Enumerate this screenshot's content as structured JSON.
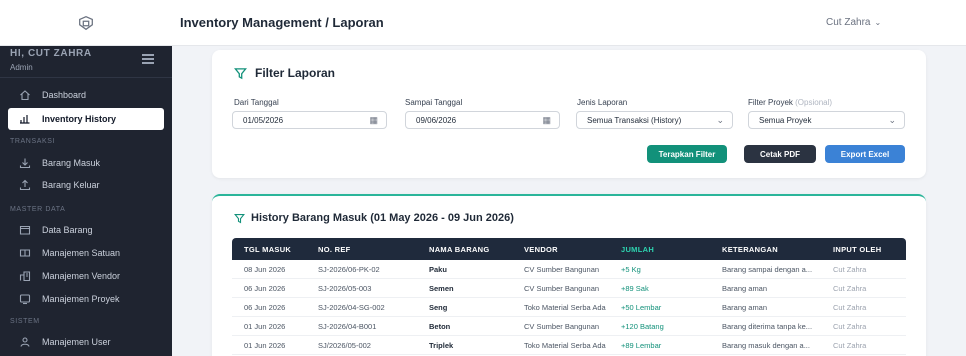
{
  "header": {
    "title": "Inventory Management / Laporan",
    "user": "Cut Zahra"
  },
  "sidebar": {
    "greeting": "HI, CUT ZAHRA",
    "role": "Admin",
    "items": [
      {
        "label": "Dashboard",
        "icon": "home-icon"
      },
      {
        "label": "Inventory History",
        "icon": "bar-chart-icon",
        "active": true
      },
      {
        "section": "TRANSAKSI"
      },
      {
        "label": "Barang Masuk",
        "icon": "download-icon"
      },
      {
        "label": "Barang Keluar",
        "icon": "upload-icon"
      },
      {
        "section": "MASTER DATA"
      },
      {
        "label": "Data Barang",
        "icon": "box-icon"
      },
      {
        "label": "Manajemen Satuan",
        "icon": "scale-icon"
      },
      {
        "label": "Manajemen Vendor",
        "icon": "vendor-icon"
      },
      {
        "label": "Manajemen Proyek",
        "icon": "monitor-icon"
      },
      {
        "section": "SISTEM"
      },
      {
        "label": "Manajemen User",
        "icon": "users-icon"
      }
    ]
  },
  "filter": {
    "title": "Filter Laporan",
    "dari_label": "Dari Tanggal",
    "dari_value": "01/05/2026",
    "sampai_label": "Sampai Tanggal",
    "sampai_value": "09/06/2026",
    "jenis_label": "Jenis Laporan",
    "jenis_value": "Semua Transaksi (History)",
    "proyek_label": "Filter Proyek",
    "proyek_optional": "(Opsional)",
    "proyek_value": "Semua Proyek",
    "btn_apply": "Terapkan Filter",
    "btn_pdf": "Cetak PDF",
    "btn_excel": "Export Excel"
  },
  "history": {
    "title": "History Barang Masuk (01 May 2026 - 09 Jun 2026)",
    "columns": [
      "TGL MASUK",
      "NO. REF",
      "NAMA BARANG",
      "VENDOR",
      "JUMLAH",
      "KETERANGAN",
      "INPUT OLEH"
    ],
    "rows": [
      [
        "08 Jun 2026",
        "SJ-2026/06-PK-02",
        "Paku",
        "CV Sumber Bangunan",
        "+5 Kg",
        "Barang sampai dengan a...",
        "Cut Zahra"
      ],
      [
        "06 Jun 2026",
        "SJ-2026/05-003",
        "Semen",
        "CV Sumber Bangunan",
        "+89 Sak",
        "Barang aman",
        "Cut Zahra"
      ],
      [
        "06 Jun 2026",
        "SJ-2026/04-SG-002",
        "Seng",
        "Toko Material Serba Ada",
        "+50 Lembar",
        "Barang aman",
        "Cut Zahra"
      ],
      [
        "01 Jun 2026",
        "SJ-2026/04-B001",
        "Beton",
        "CV Sumber Bangunan",
        "+120 Batang",
        "Barang diterima tanpa ke...",
        "Cut Zahra"
      ],
      [
        "01 Jun 2026",
        "SJ/2026/05-002",
        "Triplek",
        "Toko Material Serba Ada",
        "+89 Lembar",
        "Barang masuk dengan a...",
        "Cut Zahra"
      ]
    ]
  },
  "colors": {
    "sidebar_bg": "#1f2430",
    "accent": "#12917a",
    "table_head": "#1f2a3c",
    "excel": "#3b82d6"
  }
}
